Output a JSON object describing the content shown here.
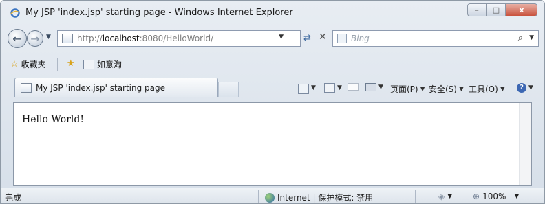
{
  "window": {
    "title": "My JSP 'index.jsp' starting page - Windows Internet Explorer",
    "controls": {
      "minimize": "–",
      "maximize": "□",
      "close": "x"
    }
  },
  "address": {
    "url_prefix": "http://",
    "url_host": "localhost",
    "url_rest": ":8080/HelloWorld/",
    "search_placeholder": "Bing"
  },
  "favorites_bar": {
    "favorites_label": "收藏夹",
    "link_label": "如意淘"
  },
  "tab": {
    "label": "My JSP 'index.jsp' starting page"
  },
  "command_bar": {
    "page_menu": "页面(P)",
    "safety_menu": "安全(S)",
    "tools_menu": "工具(O)"
  },
  "content": {
    "text": "Hello World!"
  },
  "status_bar": {
    "status": "完成",
    "zone": "Internet | 保护模式: 禁用",
    "zoom": "100%"
  },
  "icons": [
    "ie-logo-icon",
    "back-arrow-icon",
    "forward-arrow-icon",
    "page-icon",
    "refresh-icon",
    "stop-icon",
    "bing-icon",
    "search-icon",
    "star-icon",
    "home-icon",
    "feed-icon",
    "mail-icon",
    "print-icon",
    "help-icon",
    "globe-icon",
    "zoom-icon"
  ]
}
